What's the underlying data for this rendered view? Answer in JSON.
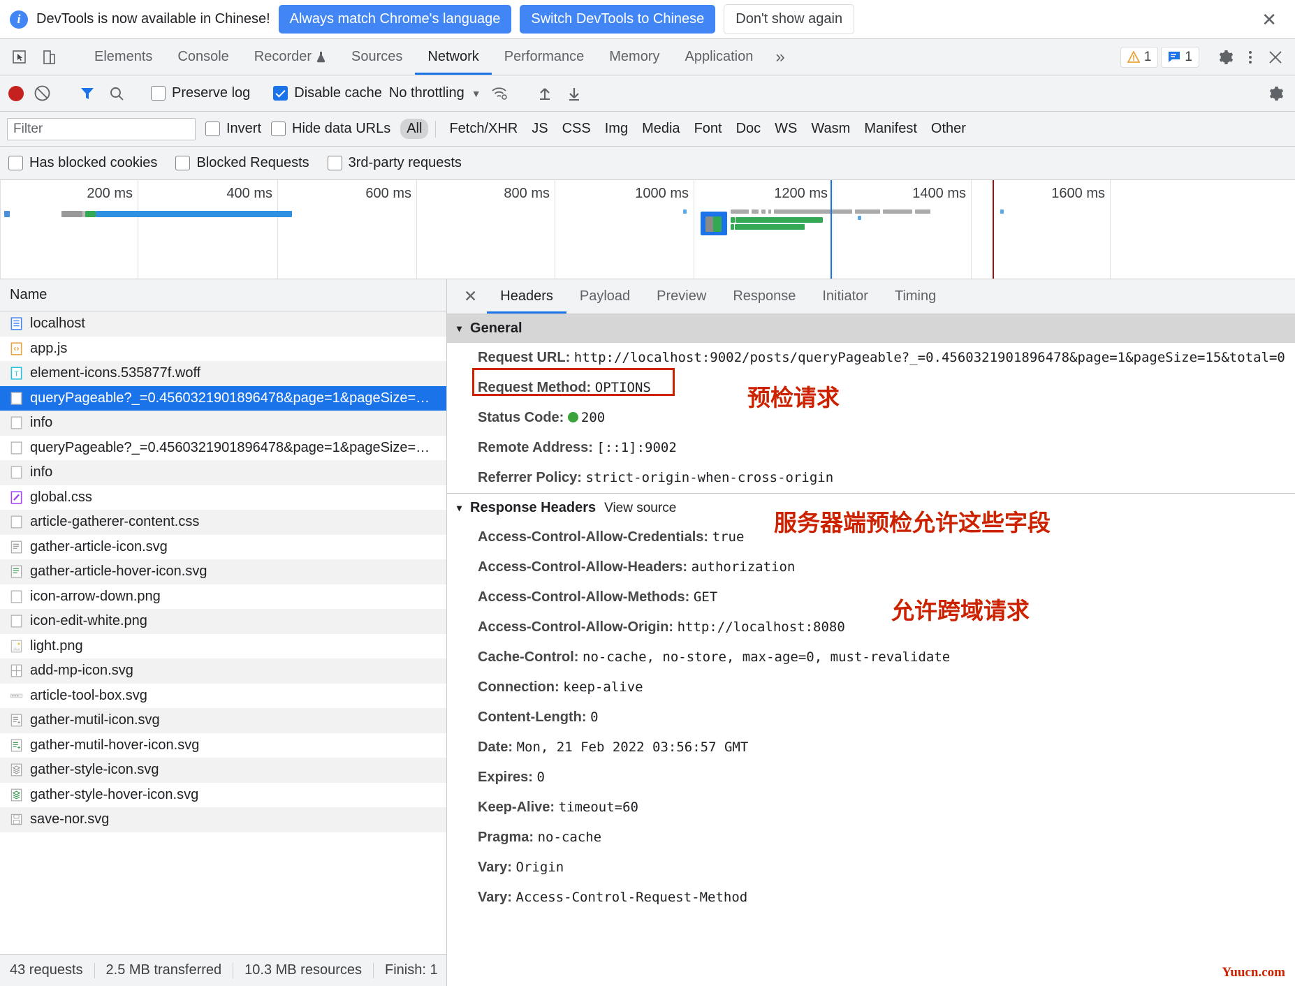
{
  "infobar": {
    "message": "DevTools is now available in Chinese!",
    "btn_always": "Always match Chrome's language",
    "btn_switch": "Switch DevTools to Chinese",
    "btn_dismiss": "Don't show again",
    "close": "✕",
    "info_glyph": "i"
  },
  "tabbar": {
    "inspect_icon": "inspect-element-icon",
    "device_icon": "device-toolbar-icon",
    "tabs": [
      {
        "label": "Elements",
        "active": false,
        "badge": ""
      },
      {
        "label": "Console",
        "active": false,
        "badge": ""
      },
      {
        "label": "Recorder",
        "active": false,
        "badge": "flask-icon"
      },
      {
        "label": "Sources",
        "active": false,
        "badge": ""
      },
      {
        "label": "Network",
        "active": true,
        "badge": ""
      },
      {
        "label": "Performance",
        "active": false,
        "badge": ""
      },
      {
        "label": "Memory",
        "active": false,
        "badge": ""
      },
      {
        "label": "Application",
        "active": false,
        "badge": ""
      }
    ],
    "more": "»",
    "warning_count": "1",
    "message_count": "1",
    "settings_icon": "gear-icon",
    "kebab_icon": "more-options-icon",
    "close_icon": "close-devtools-icon"
  },
  "nettoolbar": {
    "record_title": "record-button",
    "clear_title": "clear-button",
    "filter_title": "filter-toggle",
    "search_title": "search-button",
    "preserve_log": "Preserve log",
    "preserve_log_checked": false,
    "disable_cache": "Disable cache",
    "disable_cache_checked": true,
    "throttling": "No throttling",
    "throttle_caret": "▼",
    "wifi_icon": "network-conditions-icon",
    "import_icon": "import-har-icon",
    "export_icon": "export-har-icon",
    "settings_icon": "network-settings-icon"
  },
  "filterbar": {
    "filter_value": "",
    "filter_placeholder": "Filter",
    "invert": "Invert",
    "invert_checked": false,
    "hide_data_urls": "Hide data URLs",
    "hide_data_urls_checked": false,
    "types": [
      {
        "label": "All",
        "active": true
      },
      {
        "label": "Fetch/XHR",
        "active": false
      },
      {
        "label": "JS",
        "active": false
      },
      {
        "label": "CSS",
        "active": false
      },
      {
        "label": "Img",
        "active": false
      },
      {
        "label": "Media",
        "active": false
      },
      {
        "label": "Font",
        "active": false
      },
      {
        "label": "Doc",
        "active": false
      },
      {
        "label": "WS",
        "active": false
      },
      {
        "label": "Wasm",
        "active": false
      },
      {
        "label": "Manifest",
        "active": false
      },
      {
        "label": "Other",
        "active": false
      }
    ]
  },
  "options": [
    {
      "label": "Has blocked cookies",
      "checked": false
    },
    {
      "label": "Blocked Requests",
      "checked": false
    },
    {
      "label": "3rd-party requests",
      "checked": false
    }
  ],
  "overview": {
    "ticks": [
      "200 ms",
      "400 ms",
      "600 ms",
      "800 ms",
      "1000 ms",
      "1200 ms",
      "1400 ms",
      "1600 ms"
    ],
    "blue_marker_color": "#1a73e8",
    "red_marker_color": "#a50e0e"
  },
  "requests": {
    "column_name": "Name",
    "rows": [
      {
        "name": "localhost",
        "icon": "document-icon",
        "selected": false
      },
      {
        "name": "app.js",
        "icon": "script-icon",
        "selected": false
      },
      {
        "name": "element-icons.535877f.woff",
        "icon": "font-icon",
        "selected": false
      },
      {
        "name": "queryPageable?_=0.4560321901896478&page=1&pageSize=…",
        "icon": "generic-icon",
        "selected": true
      },
      {
        "name": "info",
        "icon": "generic-icon",
        "selected": false
      },
      {
        "name": "queryPageable?_=0.4560321901896478&page=1&pageSize=…",
        "icon": "generic-icon",
        "selected": false
      },
      {
        "name": "info",
        "icon": "generic-icon",
        "selected": false
      },
      {
        "name": "global.css",
        "icon": "stylesheet-icon",
        "selected": false
      },
      {
        "name": "article-gatherer-content.css",
        "icon": "generic-icon",
        "selected": false
      },
      {
        "name": "gather-article-icon.svg",
        "icon": "image-icon",
        "selected": false
      },
      {
        "name": "gather-article-hover-icon.svg",
        "icon": "image-icon",
        "selected": false
      },
      {
        "name": "icon-arrow-down.png",
        "icon": "generic-icon",
        "selected": false
      },
      {
        "name": "icon-edit-white.png",
        "icon": "generic-icon",
        "selected": false
      },
      {
        "name": "light.png",
        "icon": "image-icon",
        "selected": false
      },
      {
        "name": "add-mp-icon.svg",
        "icon": "image-icon",
        "selected": false
      },
      {
        "name": "article-tool-box.svg",
        "icon": "image-icon",
        "selected": false
      },
      {
        "name": "gather-mutil-icon.svg",
        "icon": "image-icon",
        "selected": false
      },
      {
        "name": "gather-mutil-hover-icon.svg",
        "icon": "image-icon",
        "selected": false
      },
      {
        "name": "gather-style-icon.svg",
        "icon": "image-icon",
        "selected": false
      },
      {
        "name": "gather-style-hover-icon.svg",
        "icon": "image-icon",
        "selected": false
      },
      {
        "name": "save-nor.svg",
        "icon": "image-icon",
        "selected": false
      }
    ],
    "footer": {
      "requests": "43 requests",
      "transferred": "2.5 MB transferred",
      "resources": "10.3 MB resources",
      "finish": "Finish: 1"
    }
  },
  "detail": {
    "close": "✕",
    "tabs": [
      {
        "label": "Headers",
        "active": true
      },
      {
        "label": "Payload",
        "active": false
      },
      {
        "label": "Preview",
        "active": false
      },
      {
        "label": "Response",
        "active": false
      },
      {
        "label": "Initiator",
        "active": false
      },
      {
        "label": "Timing",
        "active": false
      }
    ],
    "general": {
      "title": "General",
      "triangle": "▾",
      "rows": [
        {
          "name": "Request URL:",
          "value": "http://localhost:9002/posts/queryPageable?_=0.4560321901896478&page=1&pageSize=15&total=0"
        },
        {
          "name": "Request Method:",
          "value": "OPTIONS"
        },
        {
          "name": "Status Code:",
          "value": "200",
          "status": true
        },
        {
          "name": "Remote Address:",
          "value": "[::1]:9002"
        },
        {
          "name": "Referrer Policy:",
          "value": "strict-origin-when-cross-origin"
        }
      ]
    },
    "response_headers": {
      "title": "Response Headers",
      "triangle": "▾",
      "view_source": "View source",
      "rows": [
        {
          "name": "Access-Control-Allow-Credentials:",
          "value": "true"
        },
        {
          "name": "Access-Control-Allow-Headers:",
          "value": "authorization"
        },
        {
          "name": "Access-Control-Allow-Methods:",
          "value": "GET"
        },
        {
          "name": "Access-Control-Allow-Origin:",
          "value": "http://localhost:8080"
        },
        {
          "name": "Cache-Control:",
          "value": "no-cache, no-store, max-age=0, must-revalidate"
        },
        {
          "name": "Connection:",
          "value": "keep-alive"
        },
        {
          "name": "Content-Length:",
          "value": "0"
        },
        {
          "name": "Date:",
          "value": "Mon, 21 Feb 2022 03:56:57 GMT"
        },
        {
          "name": "Expires:",
          "value": "0"
        },
        {
          "name": "Keep-Alive:",
          "value": "timeout=60"
        },
        {
          "name": "Pragma:",
          "value": "no-cache"
        },
        {
          "name": "Vary:",
          "value": "Origin"
        },
        {
          "name": "Vary:",
          "value": "Access-Control-Request-Method"
        }
      ]
    }
  },
  "annotations": {
    "note_preflight": "预检请求",
    "note_server_allow": "服务器端预检允许这些字段",
    "note_cors": "允许跨域请求",
    "watermark": "Yuucn.com",
    "highlight_color": "#cc2200"
  }
}
